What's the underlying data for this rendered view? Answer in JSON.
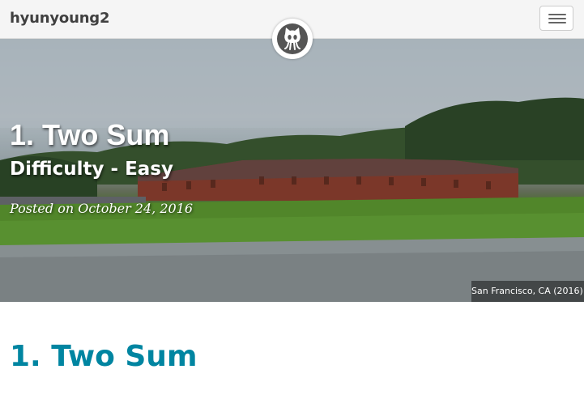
{
  "navbar": {
    "brand": "hyunyoung2",
    "menu_icon": "hamburger-menu-icon",
    "avatar_icon": "github-octocat-icon"
  },
  "header": {
    "title": "1. Two Sum",
    "subtitle": "Difficulty - Easy",
    "meta": "Posted on October 24, 2016",
    "image_caption": "San Francisco, CA (2016)"
  },
  "post": {
    "title": "1. Two Sum"
  },
  "colors": {
    "title_link": "#0085a1",
    "navbar_bg": "#f5f5f5",
    "brand_text": "#404040"
  }
}
